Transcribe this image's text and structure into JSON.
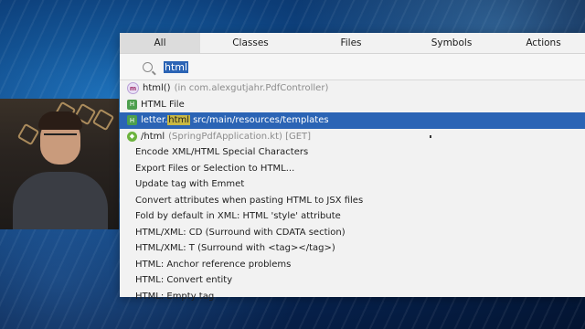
{
  "tabs": [
    "All",
    "Classes",
    "Files",
    "Symbols",
    "Actions"
  ],
  "search": {
    "value": "html"
  },
  "results": [
    {
      "icon": "method-icon",
      "name": "html()",
      "detail": "(in com.alexgutjahr.PdfController)"
    },
    {
      "icon": "html-file-icon",
      "name": "HTML File",
      "detail": ""
    },
    {
      "icon": "html-file-icon",
      "prefix": "letter.",
      "match": "html",
      "detail": "src/main/resources/templates",
      "selected": true
    },
    {
      "icon": "spring-endpoint-icon",
      "name": "/html",
      "detail": "(SpringPdfApplication.kt)  [GET]"
    },
    {
      "name": "Encode XML/HTML Special Characters"
    },
    {
      "name": "Export Files or Selection to HTML..."
    },
    {
      "name": "Update tag with Emmet"
    },
    {
      "name": "Convert attributes when pasting HTML to JSX files"
    },
    {
      "name": "Fold by default in XML: HTML 'style' attribute"
    },
    {
      "name": "HTML/XML: CD (Surround with CDATA section)"
    },
    {
      "name": "HTML/XML: T (Surround with <tag></tag>)"
    },
    {
      "name": "HTML: Anchor reference problems"
    },
    {
      "name": "HTML: Convert entity"
    },
    {
      "name": "HTML: Empty tag"
    }
  ],
  "colors": {
    "selection": "#2b64b5",
    "match_highlight": "#d8c95a"
  }
}
